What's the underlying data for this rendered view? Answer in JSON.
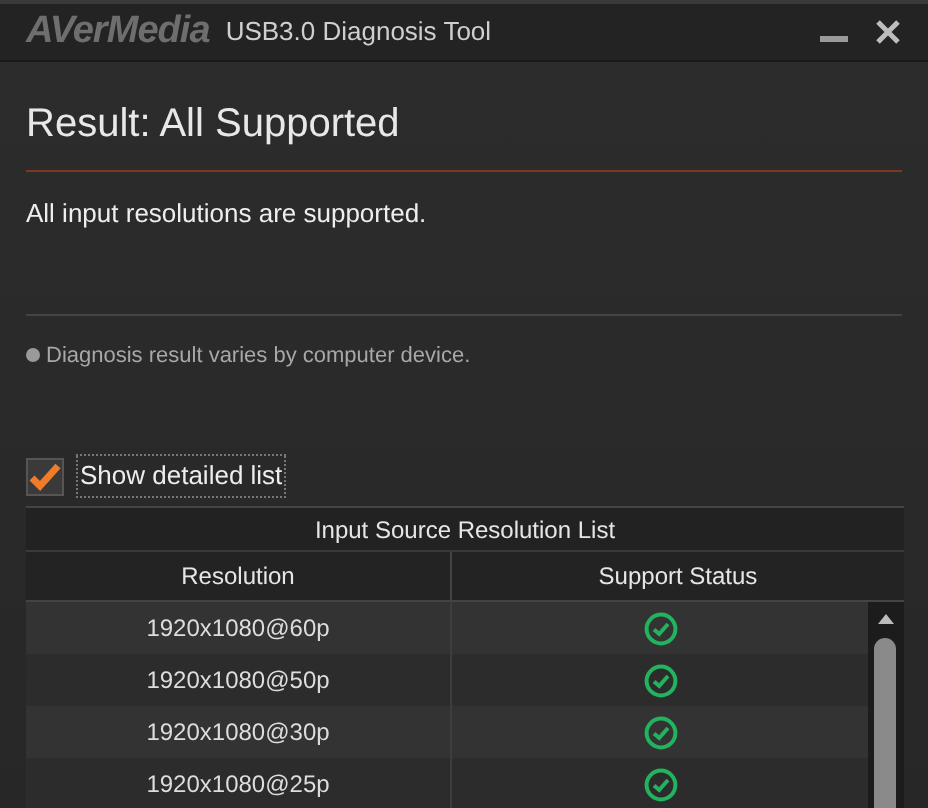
{
  "window": {
    "logo": "AVerMedia",
    "title": "USB3.0 Diagnosis Tool"
  },
  "result": {
    "heading": "Result: All Supported",
    "message": "All input resolutions are supported."
  },
  "note": "Diagnosis result varies by computer device.",
  "show_detailed_list": {
    "label": "Show detailed list",
    "checked": true
  },
  "table": {
    "caption": "Input Source Resolution List",
    "columns": [
      "Resolution",
      "Support Status"
    ],
    "rows": [
      {
        "resolution": "1920x1080@60p",
        "kind": "supported"
      },
      {
        "resolution": "1920x1080@50p",
        "kind": "supported"
      },
      {
        "resolution": "1920x1080@30p",
        "kind": "supported"
      },
      {
        "resolution": "1920x1080@25p",
        "kind": "supported"
      }
    ]
  }
}
